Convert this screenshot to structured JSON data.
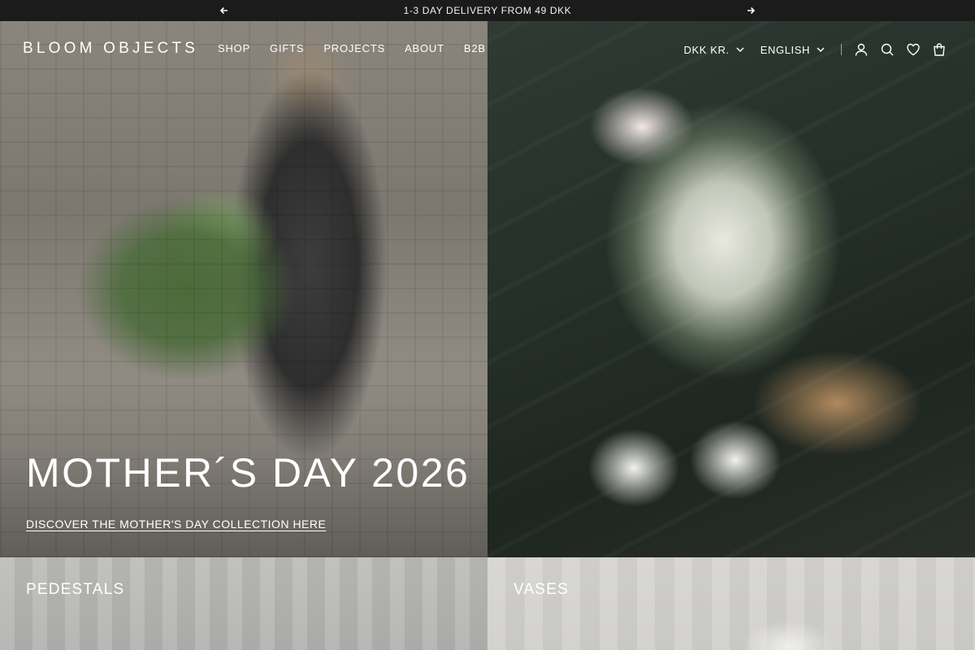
{
  "announcement": {
    "text": "1-3 DAY DELIVERY FROM 49 DKK",
    "prev_icon": "arrow-left-icon",
    "next_icon": "arrow-right-icon"
  },
  "header": {
    "logo": "BLOOM OBJECTS",
    "nav": [
      "SHOP",
      "GIFTS",
      "PROJECTS",
      "ABOUT",
      "B2B"
    ],
    "currency": "DKK KR.",
    "language": "ENGLISH",
    "icons": [
      "account-icon",
      "search-icon",
      "wishlist-icon",
      "cart-icon"
    ]
  },
  "hero": {
    "title": "MOTHER´S DAY 2026",
    "link": "DISCOVER THE MOTHER'S DAY COLLECTION HERE"
  },
  "collections": [
    {
      "label": "PEDESTALS"
    },
    {
      "label": "VASES"
    }
  ]
}
